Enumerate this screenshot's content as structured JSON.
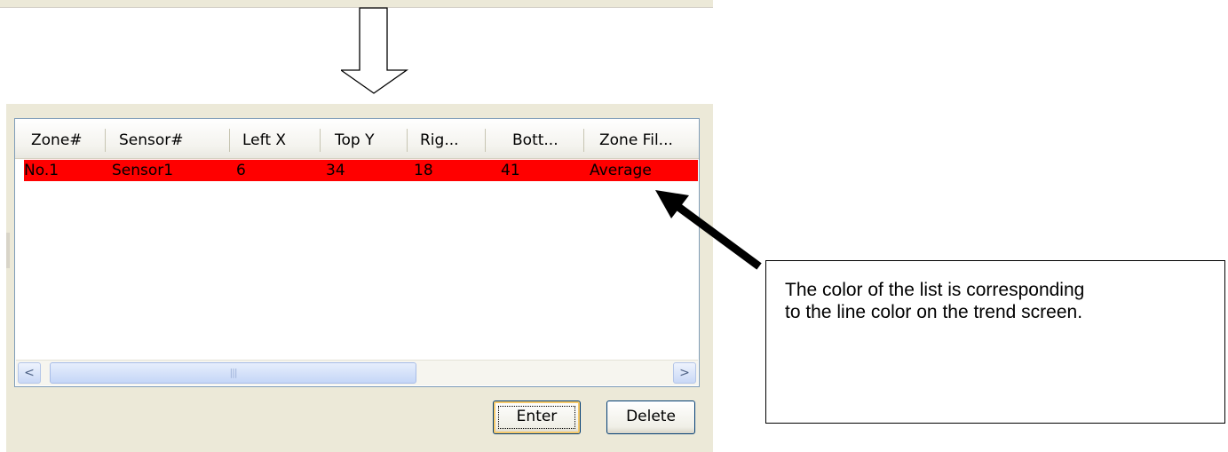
{
  "columns": [
    "Zone#",
    "Sensor#",
    "Left X",
    "Top Y",
    "Rig...",
    "Bott...",
    "Zone Fil..."
  ],
  "rows": [
    {
      "cells": [
        "No.1",
        "Sensor1",
        "6",
        "34",
        "18",
        "41",
        "Average"
      ],
      "color": "#ff0000"
    }
  ],
  "scrollbar": {
    "left_arrow": "<",
    "right_arrow": ">",
    "thumb_grip": "|||"
  },
  "buttons": {
    "enter": "Enter",
    "delete": "Delete"
  },
  "note": {
    "line1": "The color of the list is corresponding",
    "line2": "to the line color on the trend screen."
  },
  "colors": {
    "row_highlight": "#ff0000",
    "list_border": "#7f9db9",
    "panel_bg": "#ece9d8"
  },
  "icons": [
    "down-arrow-icon",
    "callout-arrow-icon"
  ]
}
